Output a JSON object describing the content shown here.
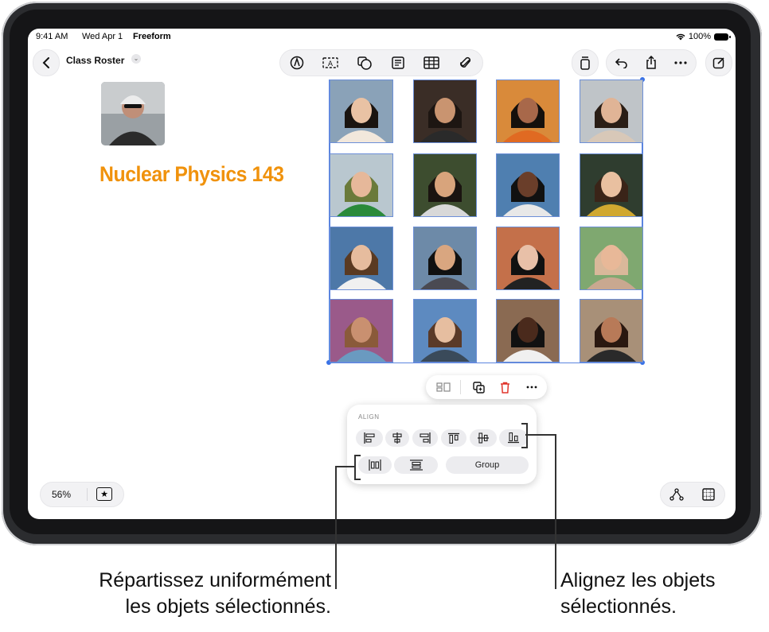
{
  "status": {
    "time": "9:41 AM",
    "date": "Wed Apr 1",
    "app": "Freeform",
    "battery": "100%"
  },
  "board": {
    "title": "Class Roster",
    "heading": "Nuclear Physics 143",
    "zoom": "56%"
  },
  "toolbar_icons": [
    "pen-icon",
    "text-box-icon",
    "shapes-icon",
    "sticky-note-icon",
    "table-icon",
    "attachment-icon"
  ],
  "align_menu": {
    "title": "ALIGN",
    "group_label": "Group"
  },
  "callouts": {
    "left_line1": "Répartissez uniformément",
    "left_line2": "les objets sélectionnés.",
    "right_line1": "Alignez les objets",
    "right_line2": "sélectionnés."
  },
  "colors": {
    "accent_orange": "#f0920c",
    "selection_blue": "#5b85e0",
    "delete_red": "#e0352b"
  }
}
